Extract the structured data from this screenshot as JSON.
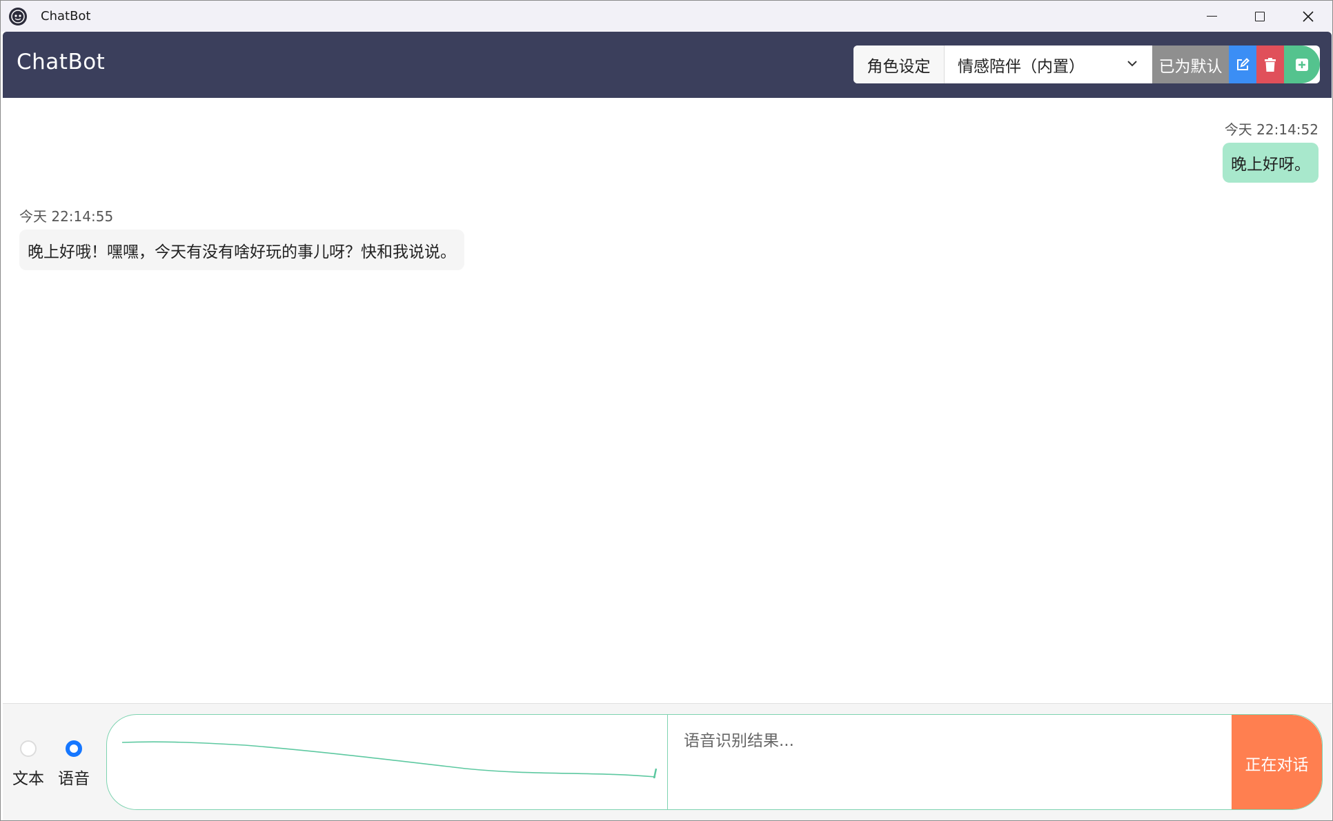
{
  "window": {
    "title": "ChatBot",
    "icon": "chatbot-app-icon"
  },
  "header": {
    "app_title": "ChatBot",
    "role_label": "角色设定",
    "role_selected": "情感陪伴（内置）",
    "default_button": "已为默认",
    "icons": [
      "edit-icon",
      "trash-icon",
      "plus-icon"
    ],
    "colors": {
      "header_bg": "#3b3f5c",
      "edit": "#3b8ef5",
      "delete": "#e0505a",
      "add": "#54c38e",
      "default_btn": "#8f8f8f"
    }
  },
  "messages": [
    {
      "role": "user",
      "time": "今天 22:14:52",
      "text": "晚上好呀。"
    },
    {
      "role": "bot",
      "time": "今天 22:14:55",
      "text": "晚上好哦！嘿嘿，今天有没有啥好玩的事儿呀？快和我说说。"
    }
  ],
  "input": {
    "modes": [
      {
        "label": "文本",
        "selected": false
      },
      {
        "label": "语音",
        "selected": true
      }
    ],
    "asr_placeholder": "语音识别结果...",
    "talk_button": "正在对话",
    "talk_color": "#ff7f50",
    "accent_color": "#7dd3b0"
  }
}
